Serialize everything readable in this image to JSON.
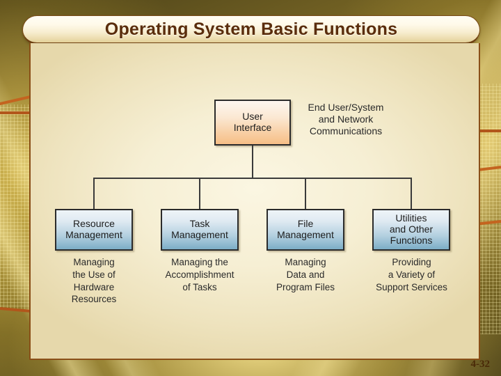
{
  "slide": {
    "title": "Operating System Basic Functions",
    "page_number": "4-32",
    "colors": {
      "title_text": "#5a2d0c",
      "panel_border": "#8a4f18",
      "root_node_fill": "#f8cfa4",
      "leaf_node_fill": "#9cc2d6",
      "background_gold": "#8f7a2c",
      "rule_orange": "#b2561b"
    }
  },
  "diagram": {
    "root": {
      "label": "User\nInterface",
      "line1": "User",
      "line2": "Interface"
    },
    "root_note": {
      "line1": "End User/System",
      "line2": "and Network",
      "line3": "Communications"
    },
    "leaves": [
      {
        "title_line1": "Resource",
        "title_line2": "Management",
        "caption_line1": "Managing",
        "caption_line2": "the Use of",
        "caption_line3": "Hardware",
        "caption_line4": "Resources"
      },
      {
        "title_line1": "Task",
        "title_line2": "Management",
        "caption_line1": "Managing the",
        "caption_line2": "Accomplishment",
        "caption_line3": "of Tasks",
        "caption_line4": ""
      },
      {
        "title_line1": "File",
        "title_line2": "Management",
        "caption_line1": "Managing",
        "caption_line2": "Data and",
        "caption_line3": "Program Files",
        "caption_line4": ""
      },
      {
        "title_line1": "Utilities",
        "title_line2": "and Other",
        "title_line3": "Functions",
        "caption_line1": "Providing",
        "caption_line2": "a Variety of",
        "caption_line3": "Support Services",
        "caption_line4": ""
      }
    ]
  }
}
